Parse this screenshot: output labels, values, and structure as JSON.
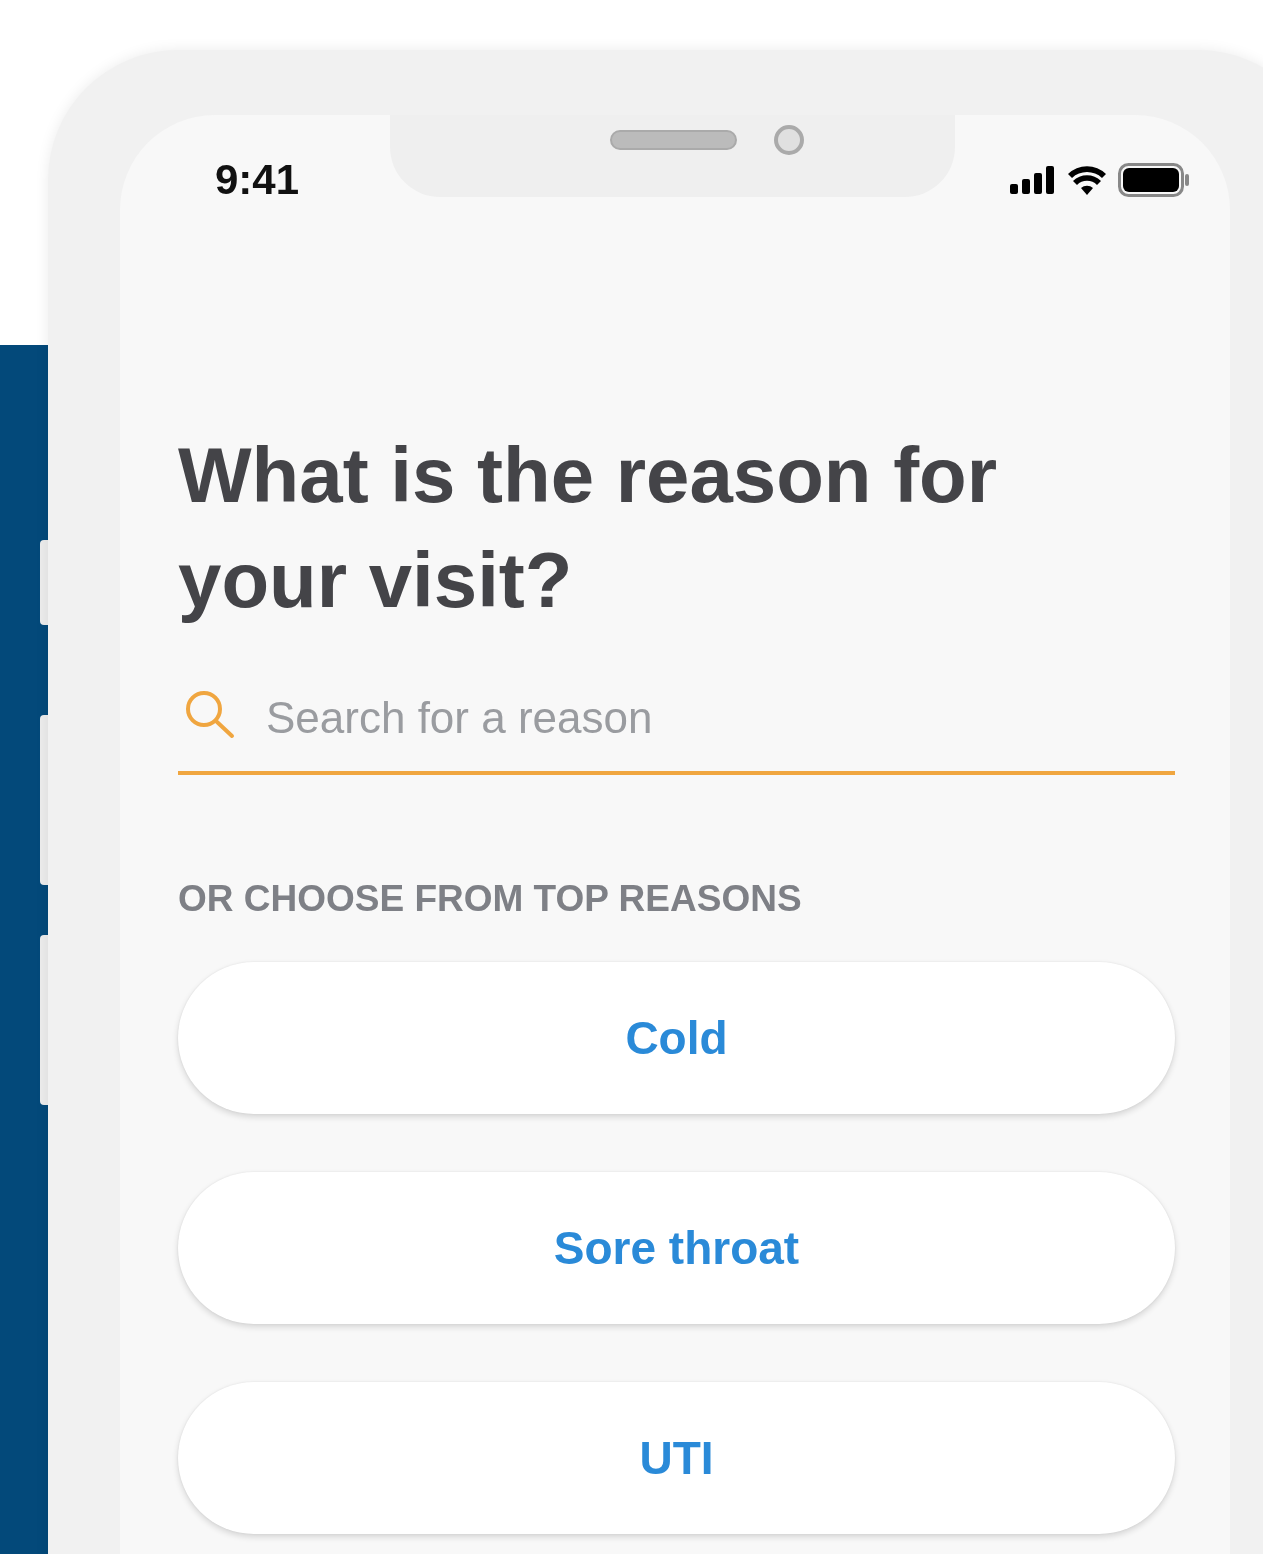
{
  "status_bar": {
    "time": "9:41"
  },
  "title": "What is the reason for your visit?",
  "search": {
    "placeholder": "Search for a reason"
  },
  "section_label": "OR CHOOSE FROM TOP REASONS",
  "reasons": [
    {
      "label": "Cold"
    },
    {
      "label": "Sore throat"
    },
    {
      "label": "UTI"
    }
  ]
}
